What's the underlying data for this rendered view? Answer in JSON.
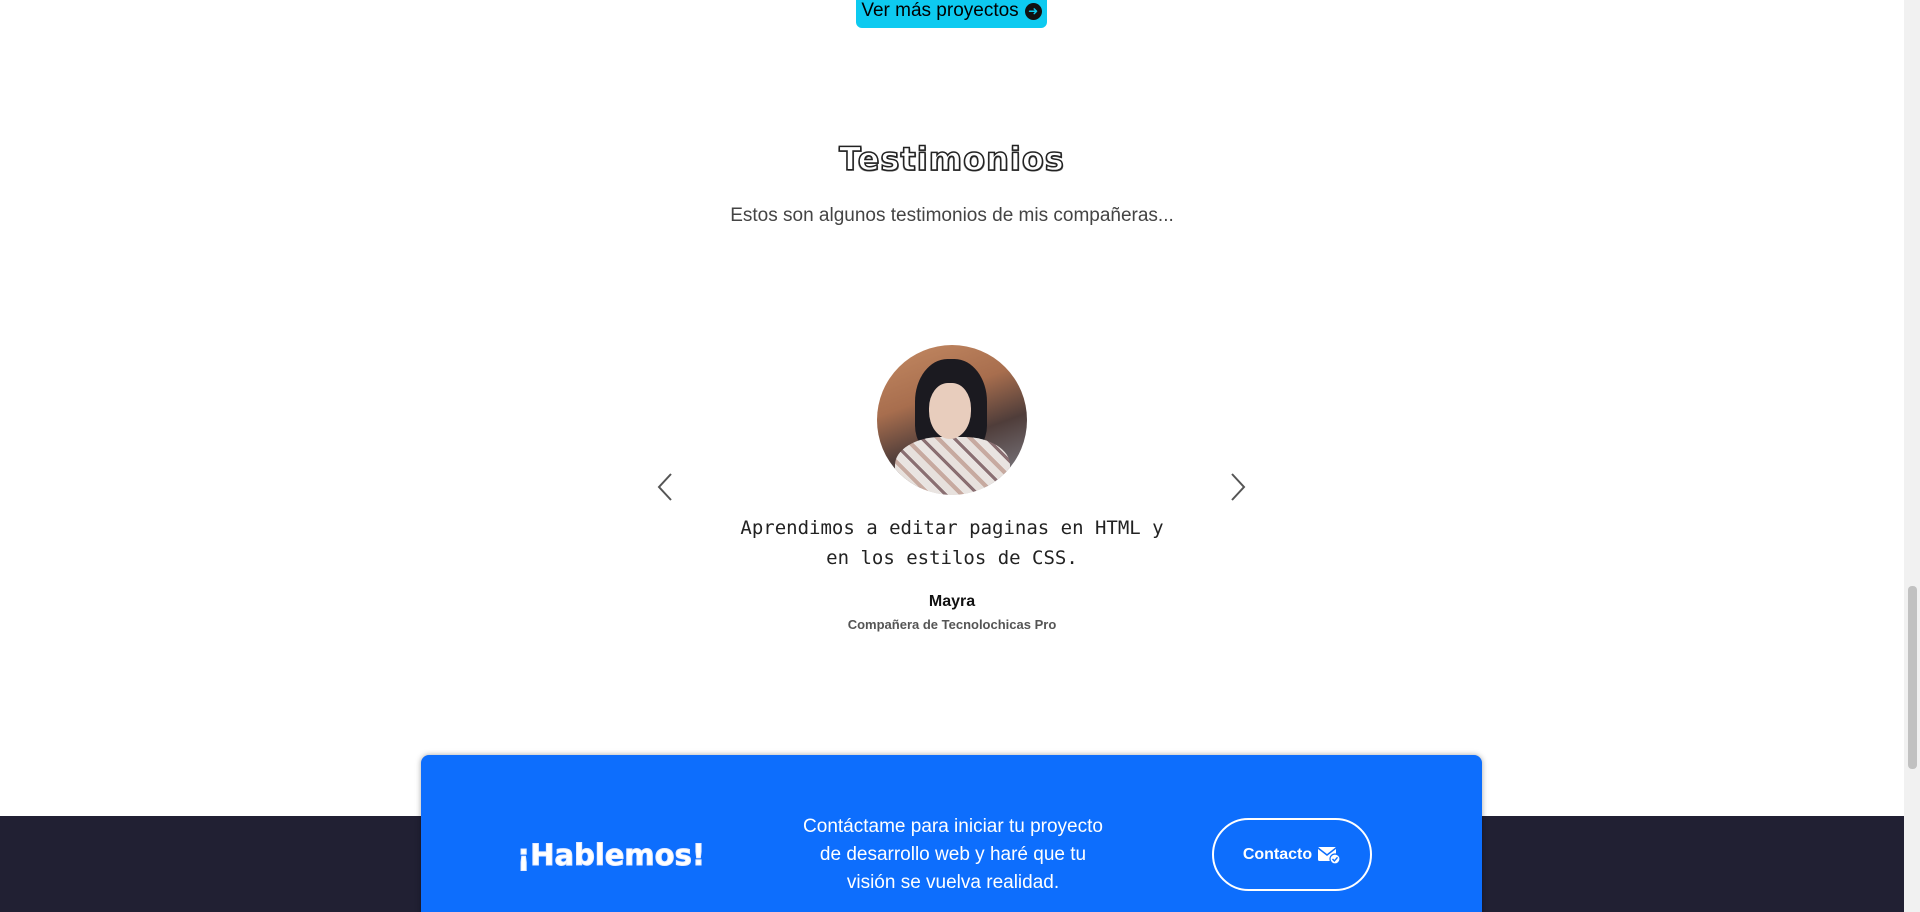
{
  "top_button": {
    "label": "Ver más proyectos",
    "icon": "arrow-right-circle-icon"
  },
  "testimonials": {
    "title": "Testimonios",
    "subtitle": "Estos son algunos testimonios de mis compañeras...",
    "quote": "Aprendimos a editar paginas en HTML y en los estilos de CSS.",
    "author": "Mayra",
    "role": "Compañera de Tecnolochicas Pro"
  },
  "cta": {
    "title": "¡Hablemos!",
    "text": "Contáctame para iniciar tu proyecto de desarrollo web y haré que tu visión se vuelva realidad.",
    "button_label": "Contacto",
    "button_icon": "envelope-check-icon",
    "accent": "#0d6efd"
  },
  "colors": {
    "button_cyan": "#0dcaf0",
    "footer_dark": "#212033"
  }
}
